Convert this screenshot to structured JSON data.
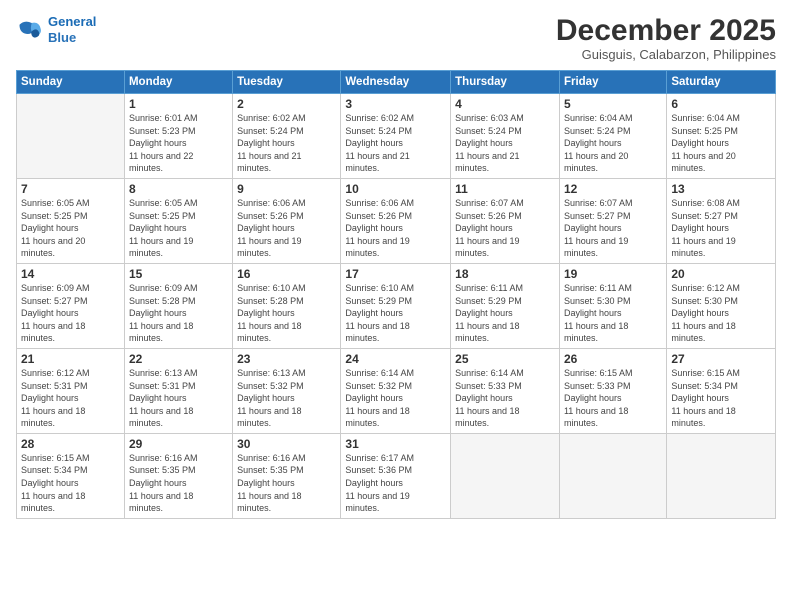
{
  "header": {
    "logo_line1": "General",
    "logo_line2": "Blue",
    "month": "December 2025",
    "location": "Guisguis, Calabarzon, Philippines"
  },
  "weekdays": [
    "Sunday",
    "Monday",
    "Tuesday",
    "Wednesday",
    "Thursday",
    "Friday",
    "Saturday"
  ],
  "weeks": [
    [
      {
        "day": "",
        "empty": true
      },
      {
        "day": "1",
        "sunrise": "6:01 AM",
        "sunset": "5:23 PM",
        "daylight": "11 hours and 22 minutes."
      },
      {
        "day": "2",
        "sunrise": "6:02 AM",
        "sunset": "5:24 PM",
        "daylight": "11 hours and 21 minutes."
      },
      {
        "day": "3",
        "sunrise": "6:02 AM",
        "sunset": "5:24 PM",
        "daylight": "11 hours and 21 minutes."
      },
      {
        "day": "4",
        "sunrise": "6:03 AM",
        "sunset": "5:24 PM",
        "daylight": "11 hours and 21 minutes."
      },
      {
        "day": "5",
        "sunrise": "6:04 AM",
        "sunset": "5:24 PM",
        "daylight": "11 hours and 20 minutes."
      },
      {
        "day": "6",
        "sunrise": "6:04 AM",
        "sunset": "5:25 PM",
        "daylight": "11 hours and 20 minutes."
      }
    ],
    [
      {
        "day": "7",
        "sunrise": "6:05 AM",
        "sunset": "5:25 PM",
        "daylight": "11 hours and 20 minutes."
      },
      {
        "day": "8",
        "sunrise": "6:05 AM",
        "sunset": "5:25 PM",
        "daylight": "11 hours and 19 minutes."
      },
      {
        "day": "9",
        "sunrise": "6:06 AM",
        "sunset": "5:26 PM",
        "daylight": "11 hours and 19 minutes."
      },
      {
        "day": "10",
        "sunrise": "6:06 AM",
        "sunset": "5:26 PM",
        "daylight": "11 hours and 19 minutes."
      },
      {
        "day": "11",
        "sunrise": "6:07 AM",
        "sunset": "5:26 PM",
        "daylight": "11 hours and 19 minutes."
      },
      {
        "day": "12",
        "sunrise": "6:07 AM",
        "sunset": "5:27 PM",
        "daylight": "11 hours and 19 minutes."
      },
      {
        "day": "13",
        "sunrise": "6:08 AM",
        "sunset": "5:27 PM",
        "daylight": "11 hours and 19 minutes."
      }
    ],
    [
      {
        "day": "14",
        "sunrise": "6:09 AM",
        "sunset": "5:27 PM",
        "daylight": "11 hours and 18 minutes."
      },
      {
        "day": "15",
        "sunrise": "6:09 AM",
        "sunset": "5:28 PM",
        "daylight": "11 hours and 18 minutes."
      },
      {
        "day": "16",
        "sunrise": "6:10 AM",
        "sunset": "5:28 PM",
        "daylight": "11 hours and 18 minutes."
      },
      {
        "day": "17",
        "sunrise": "6:10 AM",
        "sunset": "5:29 PM",
        "daylight": "11 hours and 18 minutes."
      },
      {
        "day": "18",
        "sunrise": "6:11 AM",
        "sunset": "5:29 PM",
        "daylight": "11 hours and 18 minutes."
      },
      {
        "day": "19",
        "sunrise": "6:11 AM",
        "sunset": "5:30 PM",
        "daylight": "11 hours and 18 minutes."
      },
      {
        "day": "20",
        "sunrise": "6:12 AM",
        "sunset": "5:30 PM",
        "daylight": "11 hours and 18 minutes."
      }
    ],
    [
      {
        "day": "21",
        "sunrise": "6:12 AM",
        "sunset": "5:31 PM",
        "daylight": "11 hours and 18 minutes."
      },
      {
        "day": "22",
        "sunrise": "6:13 AM",
        "sunset": "5:31 PM",
        "daylight": "11 hours and 18 minutes."
      },
      {
        "day": "23",
        "sunrise": "6:13 AM",
        "sunset": "5:32 PM",
        "daylight": "11 hours and 18 minutes."
      },
      {
        "day": "24",
        "sunrise": "6:14 AM",
        "sunset": "5:32 PM",
        "daylight": "11 hours and 18 minutes."
      },
      {
        "day": "25",
        "sunrise": "6:14 AM",
        "sunset": "5:33 PM",
        "daylight": "11 hours and 18 minutes."
      },
      {
        "day": "26",
        "sunrise": "6:15 AM",
        "sunset": "5:33 PM",
        "daylight": "11 hours and 18 minutes."
      },
      {
        "day": "27",
        "sunrise": "6:15 AM",
        "sunset": "5:34 PM",
        "daylight": "11 hours and 18 minutes."
      }
    ],
    [
      {
        "day": "28",
        "sunrise": "6:15 AM",
        "sunset": "5:34 PM",
        "daylight": "11 hours and 18 minutes."
      },
      {
        "day": "29",
        "sunrise": "6:16 AM",
        "sunset": "5:35 PM",
        "daylight": "11 hours and 18 minutes."
      },
      {
        "day": "30",
        "sunrise": "6:16 AM",
        "sunset": "5:35 PM",
        "daylight": "11 hours and 18 minutes."
      },
      {
        "day": "31",
        "sunrise": "6:17 AM",
        "sunset": "5:36 PM",
        "daylight": "11 hours and 19 minutes."
      },
      {
        "day": "",
        "empty": true
      },
      {
        "day": "",
        "empty": true
      },
      {
        "day": "",
        "empty": true
      }
    ]
  ]
}
